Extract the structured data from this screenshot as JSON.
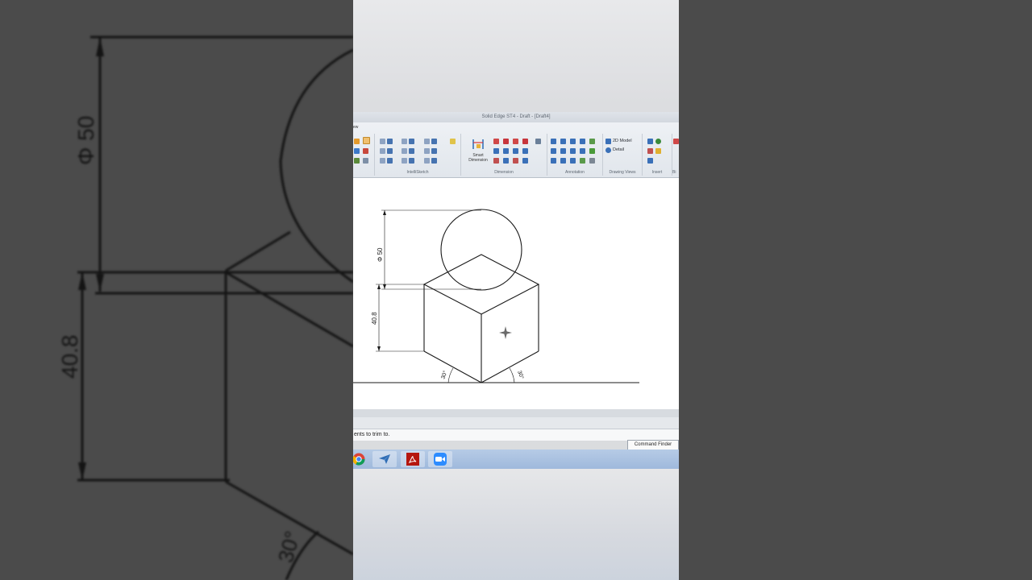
{
  "window": {
    "title": "Solid Edge ST4 - Draft - [Draft4]"
  },
  "ribbon": {
    "tab_stub": "ew",
    "groups": [
      {
        "label": "IntelliSketch"
      },
      {
        "label": "Dimension"
      },
      {
        "label": "Annotation"
      },
      {
        "label": "Drawing Views"
      },
      {
        "label": "Insert"
      },
      {
        "label": "Bi"
      }
    ],
    "smart_dimension_label": "Smart Dimension",
    "drawing_views": {
      "model_label": "2D Model",
      "detail_label": "Detail"
    }
  },
  "drawing": {
    "diameter_label": "Φ 50",
    "height_label": "40.8",
    "angle_left_label": "30°",
    "angle_right_label": "30°"
  },
  "status": {
    "prompt_text": "ents to trim to.",
    "command_finder_label": "Command Finder"
  },
  "taskbar": {
    "icons": [
      "chrome-icon",
      "send-icon",
      "acrobat-icon",
      "zoom-icon"
    ]
  },
  "colors": {
    "side_background": "#4b4b4b",
    "canvas": "#ffffff",
    "taskbar": "#a8c0e0",
    "acrobat": "#b5170f",
    "zoom": "#2d8cff"
  }
}
